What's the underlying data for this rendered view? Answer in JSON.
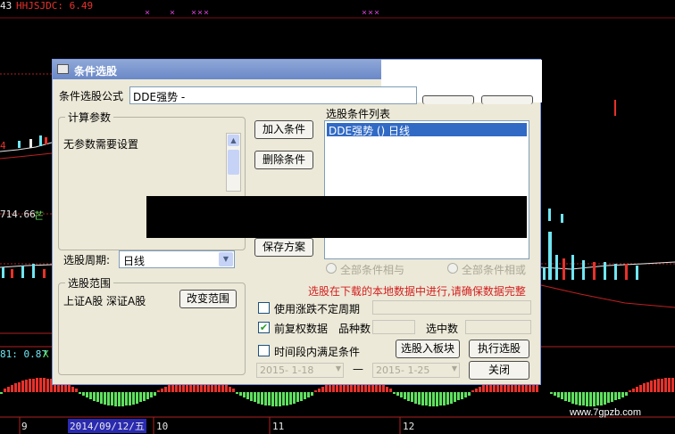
{
  "chart": {
    "indicator_label": "HHJSJDC: 6.49",
    "top_left_num": "43",
    "left_price_1": "4",
    "left_price_2": "714.66",
    "left_indicator_text": "芒",
    "left_bottom_label": "81: 0.87",
    "left_bottom_x": "X",
    "date_axis_highlight": "2014/09/12/五",
    "date_ticks": [
      "9",
      "10",
      "11",
      "12"
    ],
    "marker_glyph": "×"
  },
  "dialog": {
    "title": "条件选股",
    "formula_label": "条件选股公式",
    "formula_value": "DDE强势  -",
    "params_group_title": "计算参数",
    "params_text": "无参数需要设置",
    "period_label": "选股周期:",
    "period_value": "日线",
    "range_group_title": "选股范围",
    "range_text": "上证A股 深证A股",
    "change_range_button": "改变范围",
    "add_condition_button": "加入条件",
    "delete_condition_button": "删除条件",
    "save_plan_button": "保存方案",
    "condition_list_label": "选股条件列表",
    "condition_list_items": [
      "DDE强势  () 日线"
    ],
    "radio_and_label": "全部条件相与",
    "radio_or_label": "全部条件相或",
    "warning_text": "选股在下载的本地数据中进行,请确保数据完整",
    "use_uncertain_period_label": "使用涨跌不定周期",
    "forward_adjust_label": "前复权数据",
    "forward_adjust_checked": true,
    "variety_count_label": "品种数",
    "selected_count_label": "选中数",
    "time_period_label": "时间段内满足条件",
    "add_to_block_button": "选股入板块",
    "execute_button": "执行选股",
    "close_button": "关闭",
    "date_from": "2015- 1-18",
    "date_to": "2015- 1-25",
    "date_separator": "—"
  },
  "watermark": "www.7gpzb.com",
  "colors": {
    "chart_red": "#e8312a",
    "chart_cyan": "#6fe6f2",
    "chart_green": "#5ee05e",
    "chart_magenta": "#d040d0",
    "selection_blue": "#316ac5",
    "warning_red": "#d42020"
  }
}
